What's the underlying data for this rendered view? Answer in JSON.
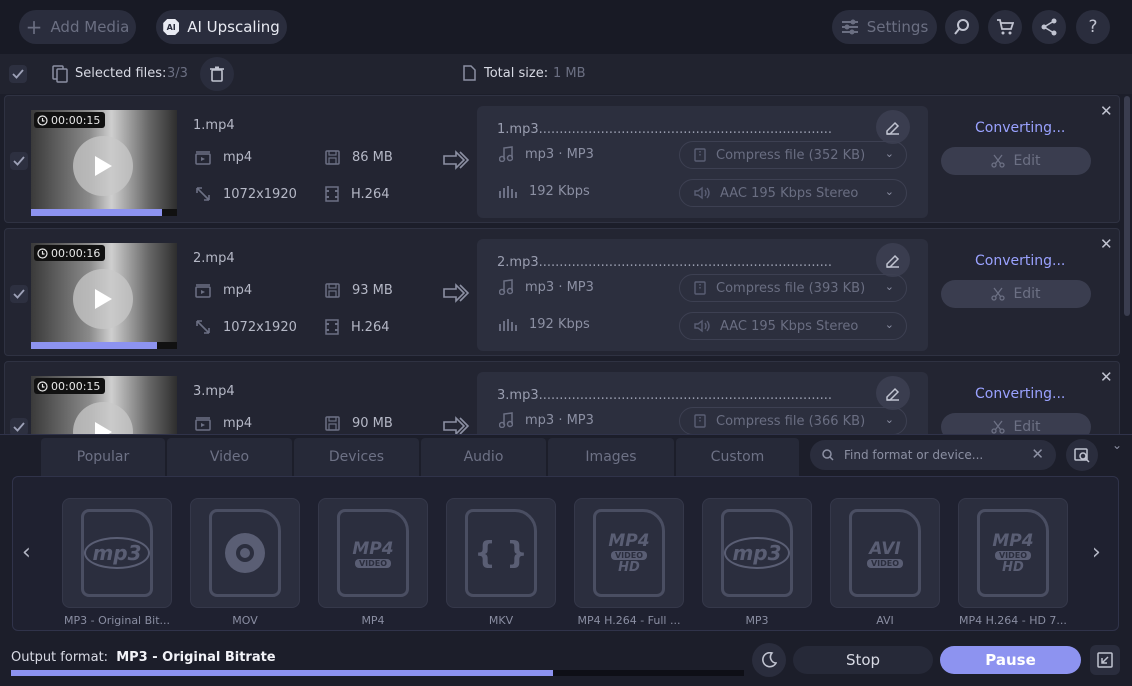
{
  "toolbar": {
    "add_media": "Add Media",
    "ai_upscaling": "AI Upscaling",
    "settings": "Settings"
  },
  "selection": {
    "label": "Selected files:",
    "count": "3/3",
    "total_label": "Total size:",
    "total_value": "1 MB"
  },
  "files": [
    {
      "duration": "00:00:15",
      "name": "1.mp4",
      "format": "mp4",
      "size": "86 MB",
      "resolution": "1072x1920",
      "codec": "H.264",
      "progress": 0.9,
      "output_name": "1.mp3.......................................................................",
      "output_format": "mp3 · MP3",
      "compress": "Compress file (352 KB)",
      "bitrate": "192 Kbps",
      "audio": "AAC 195 Kbps Stereo",
      "status": "Converting...",
      "edit": "Edit"
    },
    {
      "duration": "00:00:16",
      "name": "2.mp4",
      "format": "mp4",
      "size": "93 MB",
      "resolution": "1072x1920",
      "codec": "H.264",
      "progress": 0.86,
      "output_name": "2.mp3.......................................................................",
      "output_format": "mp3 · MP3",
      "compress": "Compress file (393 KB)",
      "bitrate": "192 Kbps",
      "audio": "AAC 195 Kbps Stereo",
      "status": "Converting...",
      "edit": "Edit"
    },
    {
      "duration": "00:00:15",
      "name": "3.mp4",
      "format": "mp4",
      "size": "90 MB",
      "output_name": "3.mp3.......................................................................",
      "output_format": "mp3 · MP3",
      "compress": "Compress file (366 KB)",
      "status": "Converting...",
      "edit": "Edit"
    }
  ],
  "tabs": [
    "Popular",
    "Video",
    "Devices",
    "Audio",
    "Images",
    "Custom"
  ],
  "search": {
    "placeholder": "Find format or device..."
  },
  "formats": [
    {
      "label": "MP3 - Original Bit...",
      "icon": "mp3"
    },
    {
      "label": "MOV",
      "icon": "quicktime"
    },
    {
      "label": "MP4",
      "icon": "MP4"
    },
    {
      "label": "MKV",
      "icon": "mkv"
    },
    {
      "label": "MP4 H.264 - Full ...",
      "icon": "MP4 HD"
    },
    {
      "label": "MP3",
      "icon": "mp3"
    },
    {
      "label": "AVI",
      "icon": "AVI"
    },
    {
      "label": "MP4 H.264 - HD 7...",
      "icon": "MP4 HD"
    }
  ],
  "bottom": {
    "output_label": "Output format:",
    "output_value": "MP3 - Original Bitrate",
    "stop": "Stop",
    "pause": "Pause",
    "progress": 0.74
  },
  "colors": {
    "accent": "#8d93f0",
    "status": "#9aa2ff"
  }
}
